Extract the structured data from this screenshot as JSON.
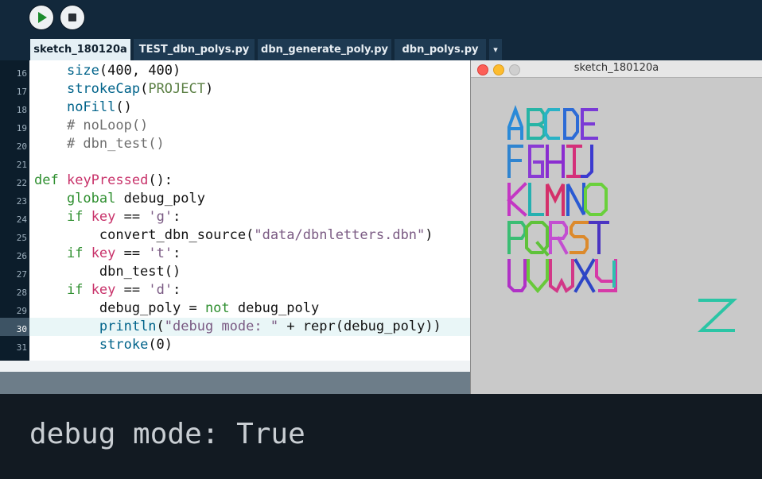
{
  "toolbar": {
    "run_icon": "play-icon",
    "stop_icon": "stop-icon"
  },
  "tabs": [
    {
      "label": "sketch_180120a",
      "active": true
    },
    {
      "label": "TEST_dbn_polys.py"
    },
    {
      "label": "dbn_generate_poly.py"
    },
    {
      "label": "dbn_polys.py"
    }
  ],
  "tab_menu_icon": "▾",
  "editor": {
    "line_numbers": [
      "16",
      "17",
      "18",
      "19",
      "20",
      "21",
      "22",
      "23",
      "24",
      "25",
      "26",
      "27",
      "28",
      "29",
      "30",
      "31"
    ],
    "current_line": "30"
  },
  "sketch_window": {
    "title": "sketch_180120a",
    "letters": "ABCDEFGHIJKLMNOPQRSTUVWXYZ"
  },
  "console": {
    "output": "debug mode: True"
  },
  "colors": {
    "editor_bg": "#ffffff",
    "gutter_bg": "#0c1d2b",
    "console_bg": "#121a22",
    "canvas_bg": "#c9c9c9"
  }
}
